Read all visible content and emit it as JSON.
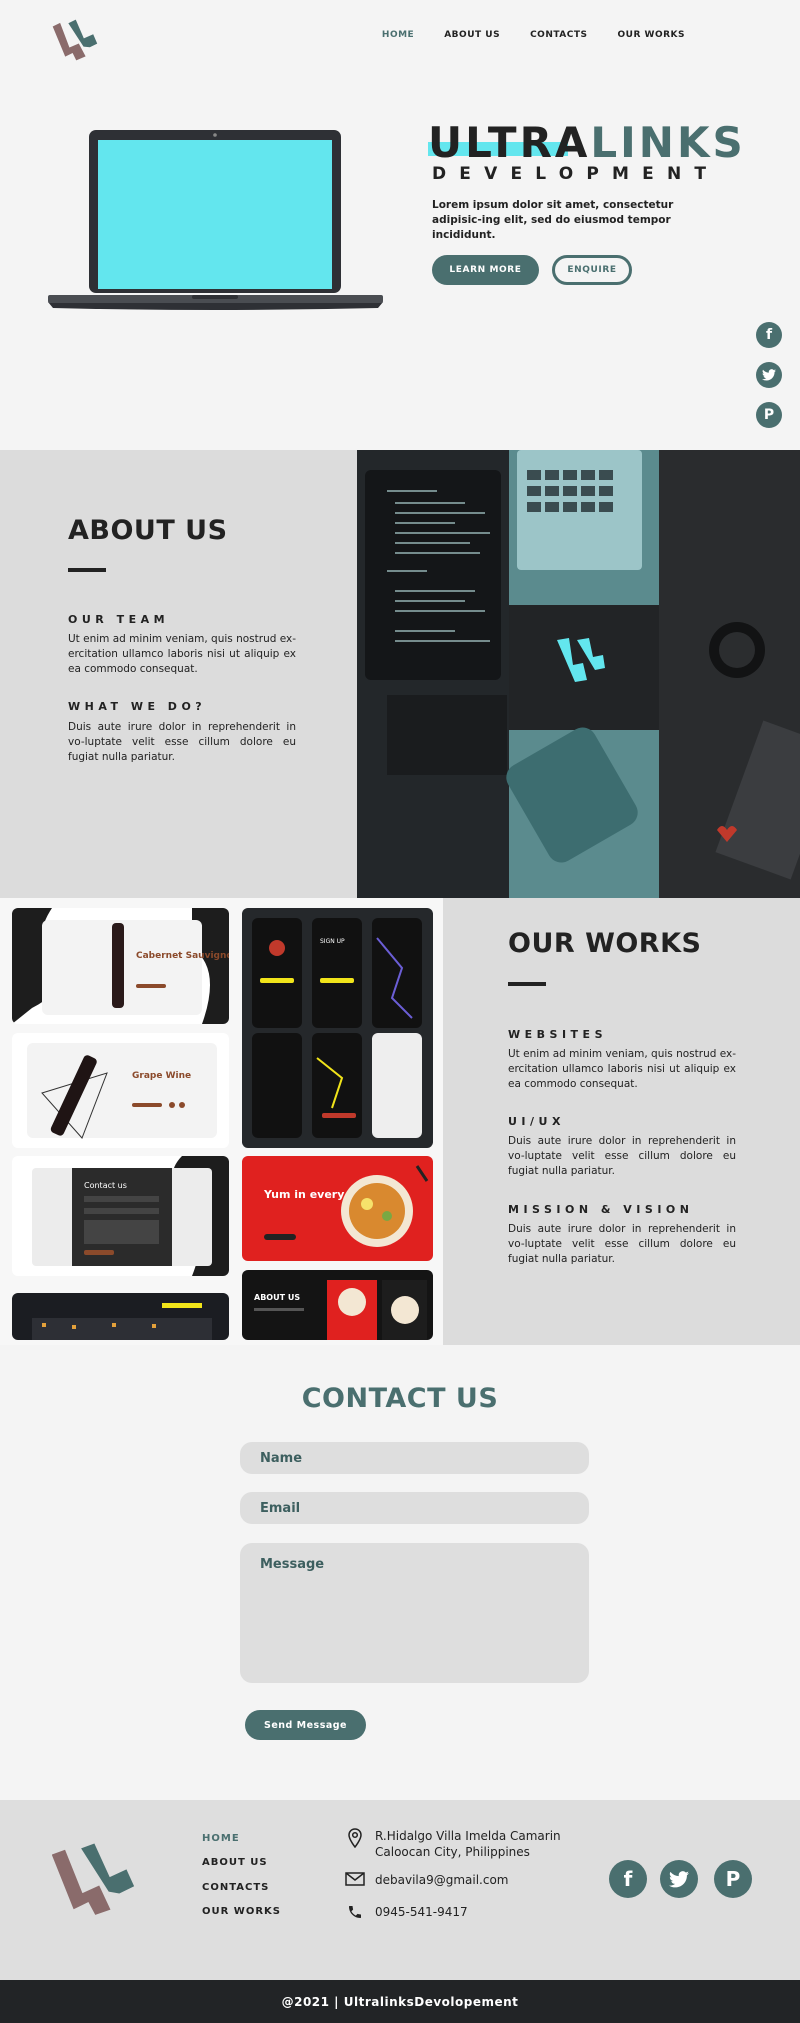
{
  "nav": {
    "items": [
      {
        "label": "HOME",
        "active": true
      },
      {
        "label": "ABOUT US",
        "active": false
      },
      {
        "label": "CONTACTS",
        "active": false
      },
      {
        "label": "OUR WORKS",
        "active": false
      }
    ]
  },
  "hero": {
    "title_part1": "ULTRA",
    "title_part2": "LINKS",
    "subtitle": "DEVELOPMENT",
    "text": "Lorem ipsum dolor sit amet, consectetur adipisic-ing elit, sed do eiusmod tempor incididunt.",
    "learn_more": "LEARN MORE",
    "enquire": "ENQUIRE"
  },
  "social": [
    "facebook-icon",
    "twitter-icon",
    "pinterest-icon"
  ],
  "about": {
    "title": "ABOUT US",
    "team_heading": "OUR TEAM",
    "team_text": "Ut enim ad minim veniam, quis nostrud ex-ercitation ullamco laboris nisi ut aliquip ex ea commodo consequat.",
    "what_heading": "WHAT WE DO?",
    "what_text": "Duis aute irure dolor in reprehenderit in vo-luptate velit esse cillum dolore eu fugiat nulla pariatur."
  },
  "works": {
    "title": "OUR WORKS",
    "websites_heading": "WEBSITES",
    "websites_text": "Ut enim ad minim veniam, quis nostrud ex-ercitation ullamco laboris nisi ut aliquip ex ea commodo consequat.",
    "uiux_heading": "UI/UX",
    "uiux_text": "Duis aute irure dolor in reprehenderit in vo-luptate velit esse cillum dolore eu fugiat nulla pariatur.",
    "mission_heading": "MISSION & VISION",
    "mission_text": "Duis aute irure dolor in reprehenderit in vo-luptate velit esse cillum dolore eu fugiat nulla pariatur.",
    "thumbs": {
      "wine1_title": "Cabernet Sauvignon",
      "wine2_title": "Grape Wine",
      "contact_title": "Contact us",
      "signup": "SIGN UP",
      "food_title": "Yum in every sip",
      "about_title": "ABOUT US"
    }
  },
  "contact": {
    "title": "CONTACT US",
    "name_placeholder": "Name",
    "email_placeholder": "Email",
    "message_placeholder": "Message",
    "send": "Send Message"
  },
  "footer": {
    "nav": [
      "HOME",
      "ABOUT US",
      "CONTACTS",
      "OUR WORKS"
    ],
    "address_line1": "R.Hidalgo Villa Imelda Camarin",
    "address_line2": "Caloocan City, Philippines",
    "email": "debavila9@gmail.com",
    "phone": "0945-541-9417",
    "copyright": "@2021 | UltralinksDevolopement"
  },
  "colors": {
    "accent": "#4a6f6f",
    "cyan": "#63e6ee",
    "dark": "#222222"
  }
}
